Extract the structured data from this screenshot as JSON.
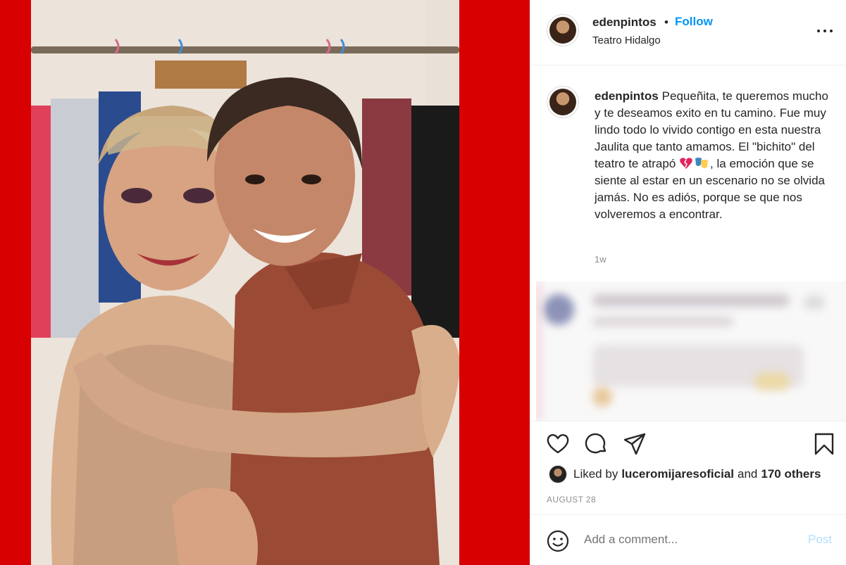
{
  "post": {
    "username": "edenpintos",
    "dot": "•",
    "follow_label": "Follow",
    "location": "Teatro Hidalgo"
  },
  "caption": {
    "username": "edenpintos",
    "text_part1": "Pequeñita, te queremos mucho y te deseamos exito en tu camino. Fue muy lindo todo lo vivido contigo en esta nuestra Jaulita que tanto amamos. El \"bichito\" del teatro te atrapó",
    "text_part2": ", la emoción que se siente al estar en un escenario no se olvida jamás. No es adiós, porque se que nos volveremos a encontrar.",
    "emoji_names": [
      "broken-heart-emoji",
      "theater-masks-emoji"
    ],
    "age": "1w"
  },
  "likes": {
    "prefix": "Liked by",
    "user": "luceromijaresoficial",
    "connector": "and",
    "others": "170 others"
  },
  "date": "AUGUST 28",
  "comment": {
    "placeholder": "Add a comment...",
    "post_label": "Post"
  },
  "colors": {
    "frame_red": "#d80000",
    "follow_blue": "#0095f6",
    "post_disabled": "#b2dffc",
    "muted": "#8e8e8e"
  },
  "icons": [
    "more-options-icon",
    "heart-icon",
    "comment-icon",
    "share-icon",
    "bookmark-icon",
    "emoji-icon"
  ]
}
